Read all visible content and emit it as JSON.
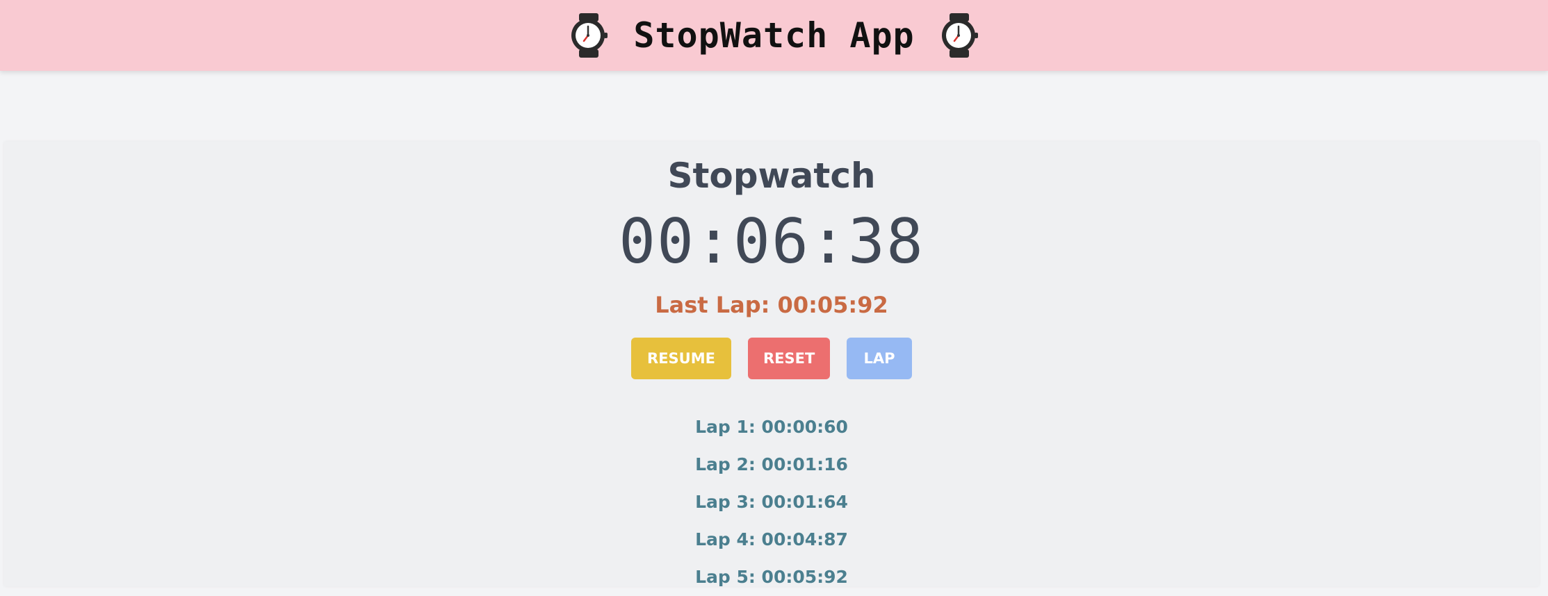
{
  "header": {
    "title": "StopWatch App",
    "left_icon": "wristwatch-icon",
    "right_icon": "wristwatch-icon"
  },
  "stopwatch": {
    "title": "Stopwatch",
    "time": "00:06:38",
    "last_lap": "Last Lap: 00:05:92"
  },
  "buttons": {
    "resume_label": "RESUME",
    "reset_label": "RESET",
    "lap_label": "LAP"
  },
  "laps": [
    "Lap 1: 00:00:60",
    "Lap 2: 00:01:16",
    "Lap 3: 00:01:64",
    "Lap 4: 00:04:87",
    "Lap 5: 00:05:92"
  ],
  "colors": {
    "header_bg": "#f9cad2",
    "resume": "#e7c03c",
    "reset": "#ec6f6f",
    "lap": "#96b9f3",
    "last_lap_text": "#c96a43",
    "lap_text": "#4b7f8f"
  }
}
